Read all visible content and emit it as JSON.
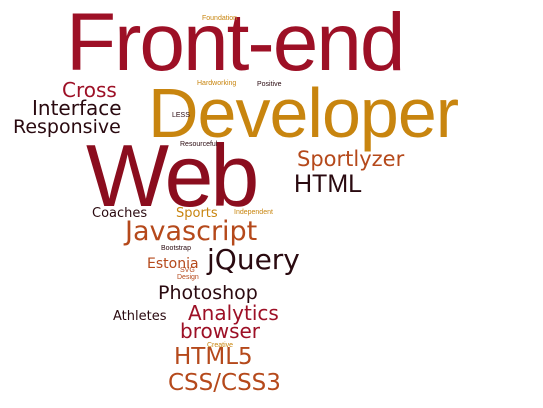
{
  "palette": {
    "dark_red": "#8b0d1e",
    "crimson": "#9d1026",
    "orange": "#c8850f",
    "rust": "#b5491b",
    "dark": "#2a0a10",
    "background": "#ffffff"
  },
  "words": {
    "frontend": {
      "text": "Front-end",
      "color": "#9d1026"
    },
    "developer": {
      "text": "Developer",
      "color": "#c8850f"
    },
    "web": {
      "text": "Web",
      "color": "#8b0d1e"
    },
    "html": {
      "text": "HTML",
      "color": "#2a0a10"
    },
    "sportlyzer": {
      "text": "Sportlyzer",
      "color": "#b5491b"
    },
    "javascript": {
      "text": "Javascript",
      "color": "#b5491b"
    },
    "jquery": {
      "text": "jQuery",
      "color": "#2a0a10"
    },
    "photoshop": {
      "text": "Photoshop",
      "color": "#2a0a10"
    },
    "analytics": {
      "text": "Analytics",
      "color": "#9d1026"
    },
    "browser": {
      "text": "browser",
      "color": "#9d1026"
    },
    "html5": {
      "text": "HTML5",
      "color": "#b5491b"
    },
    "css": {
      "text": "CSS/CSS3",
      "color": "#b5491b"
    },
    "cross": {
      "text": "Cross",
      "color": "#9d1026"
    },
    "interface": {
      "text": "Interface",
      "color": "#2a0a10"
    },
    "responsive": {
      "text": "Responsive",
      "color": "#2a0a10"
    },
    "coaches": {
      "text": "Coaches",
      "color": "#2a0a10"
    },
    "sports": {
      "text": "Sports",
      "color": "#c8850f"
    },
    "estonia": {
      "text": "Estonia",
      "color": "#b5491b"
    },
    "athletes": {
      "text": "Athletes",
      "color": "#2a0a10"
    },
    "foundation": {
      "text": "Foundation",
      "color": "#c8850f"
    },
    "hardworking": {
      "text": "Hardworking",
      "color": "#c8850f"
    },
    "positive": {
      "text": "Positive",
      "color": "#2a0a10"
    },
    "less": {
      "text": "LESS",
      "color": "#2a0a10"
    },
    "resourceful": {
      "text": "Resourceful",
      "color": "#2a0a10"
    },
    "independent": {
      "text": "Independent",
      "color": "#c8850f"
    },
    "bootstrap": {
      "text": "Bootstrap",
      "color": "#2a0a10"
    },
    "svg": {
      "text": "SVG",
      "color": "#b5491b"
    },
    "design": {
      "text": "Design",
      "color": "#b5491b"
    },
    "creative": {
      "text": "Creative",
      "color": "#c8850f"
    }
  }
}
